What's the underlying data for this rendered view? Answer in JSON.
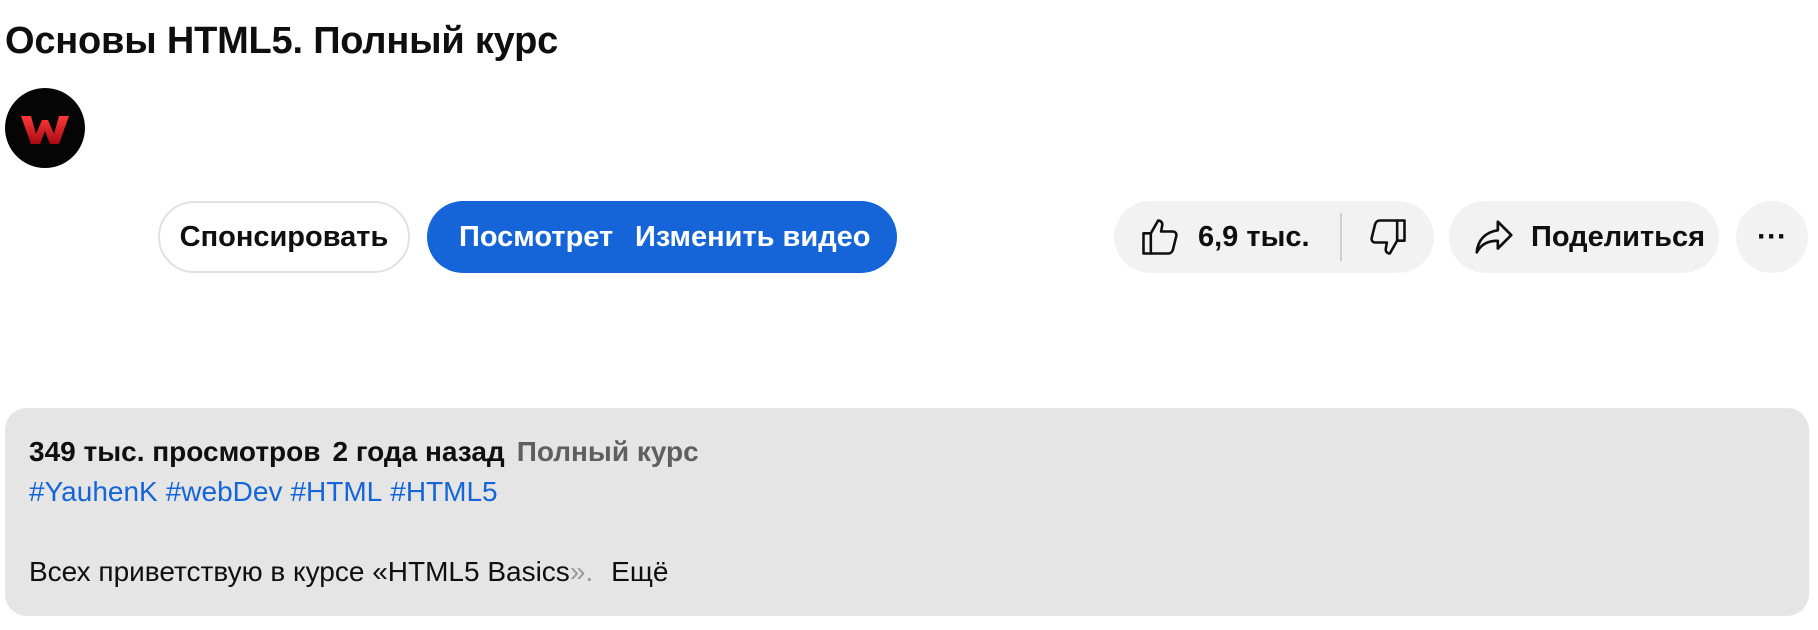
{
  "video": {
    "title": "Основы HTML5. Полный курс"
  },
  "channel": {
    "avatar_icon": "w-logo-icon",
    "avatar_colors": {
      "background": "#050505",
      "logo": "#d0121b"
    }
  },
  "actions": {
    "sponsor_label": "Спонсировать",
    "watch_label": "Посмотреть",
    "edit_video_label": "Изменить видео",
    "like_count": "6,9 тыс.",
    "like_icon": "thumbs-up-icon",
    "dislike_icon": "thumbs-down-icon",
    "share_label": "Поделиться",
    "share_icon": "share-arrow-icon",
    "more_icon": "more-horizontal-icon",
    "more_glyph": "···"
  },
  "description": {
    "views": "349 тыс. просмотров",
    "date": "2 года назад",
    "topic": "Полный курс",
    "hashtags": [
      "#YauhenK",
      "#webDev",
      "#HTML",
      "#HTML5"
    ],
    "text_main": "Всех приветствую в курсе «HTML5 Basics",
    "text_fade": "».",
    "more_label": "Ещё"
  },
  "colors": {
    "accent_blue": "#1565d8",
    "chip_background": "#f2f2f2",
    "description_background": "#e5e5e5"
  }
}
